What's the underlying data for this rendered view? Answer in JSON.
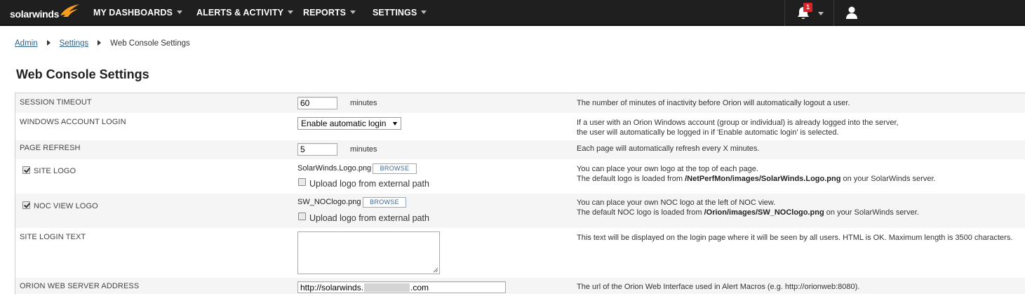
{
  "brand": {
    "name": "solarwinds",
    "accent": "#f99d1c"
  },
  "nav": {
    "items": [
      "MY DASHBOARDS",
      "ALERTS & ACTIVITY",
      "REPORTS",
      "SETTINGS"
    ],
    "notifications_count": "1"
  },
  "breadcrumb": {
    "admin": "Admin",
    "settings": "Settings",
    "current": "Web Console Settings"
  },
  "page": {
    "title": "Web Console Settings"
  },
  "settings": {
    "session_timeout": {
      "label": "SESSION TIMEOUT",
      "value": "60",
      "units": "minutes",
      "desc": "The number of minutes of inactivity before Orion will automatically logout a user."
    },
    "windows_login": {
      "label": "WINDOWS ACCOUNT LOGIN",
      "selected": "Enable automatic login",
      "desc_line1": "If a user with an Orion Windows account (group or individual) is already logged into the server,",
      "desc_line2": "the user will automatically be logged in if 'Enable automatic login' is selected."
    },
    "page_refresh": {
      "label": "PAGE REFRESH",
      "value": "5",
      "units": "minutes",
      "desc": "Each page will automatically refresh every X minutes."
    },
    "site_logo": {
      "label": "SITE LOGO",
      "checked": true,
      "filename": "SolarWinds.Logo.png",
      "browse": "BROWSE",
      "external": "Upload logo from external path",
      "desc_line1": "You can place your own logo at the top of each page.",
      "desc_line2_pre": "The default logo is loaded from ",
      "desc_line2_path": "/NetPerfMon/images/SolarWinds.Logo.png",
      "desc_line2_post": " on your SolarWinds server."
    },
    "noc_logo": {
      "label": "NOC VIEW LOGO",
      "checked": true,
      "filename": "SW_NOClogo.png",
      "browse": "BROWSE",
      "external": "Upload logo from external path",
      "desc_line1": "You can place your own NOC logo at the left of NOC view.",
      "desc_line2_pre": "The default NOC logo is loaded from ",
      "desc_line2_path": "/Orion/images/SW_NOClogo.png",
      "desc_line2_post": " on your SolarWinds server."
    },
    "login_text": {
      "label": "SITE LOGIN TEXT",
      "value": "",
      "desc": "This text will be displayed on the login page where it will be seen by all users. HTML is OK. Maximum length is 3500 characters."
    },
    "server_address": {
      "label": "ORION WEB SERVER ADDRESS",
      "value_prefix": "http://solarwinds.",
      "value_suffix": ".com",
      "desc": "The url of the Orion Web Interface used in Alert Macros (e.g. http://orionweb:8080)."
    }
  }
}
